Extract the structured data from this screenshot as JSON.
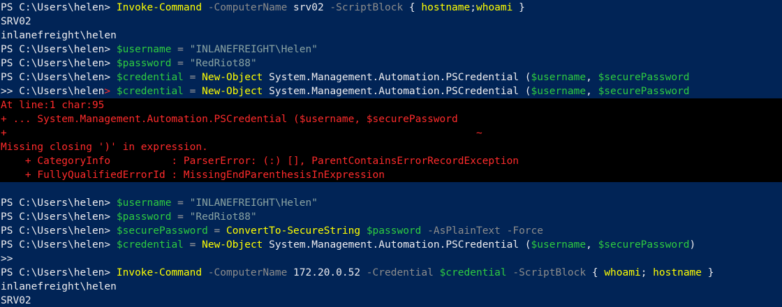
{
  "lines": [
    {
      "kind": "normal",
      "segs": [
        {
          "t": "PS C:\\Users\\helen> ",
          "c": "prompt"
        },
        {
          "t": "Invoke-Command",
          "c": "cmd"
        },
        {
          "t": " -ComputerName",
          "c": "param"
        },
        {
          "t": " srv02",
          "c": "plain"
        },
        {
          "t": " -ScriptBlock",
          "c": "param"
        },
        {
          "t": " { ",
          "c": "plain"
        },
        {
          "t": "hostname",
          "c": "cmd"
        },
        {
          "t": ";",
          "c": "plain"
        },
        {
          "t": "whoami",
          "c": "cmd"
        },
        {
          "t": " }",
          "c": "plain"
        }
      ]
    },
    {
      "kind": "normal",
      "segs": [
        {
          "t": "SRV02",
          "c": "plain"
        }
      ]
    },
    {
      "kind": "normal",
      "segs": [
        {
          "t": "inlanefreight\\helen",
          "c": "plain"
        }
      ]
    },
    {
      "kind": "normal",
      "segs": [
        {
          "t": "PS C:\\Users\\helen> ",
          "c": "prompt"
        },
        {
          "t": "$username",
          "c": "var"
        },
        {
          "t": " = ",
          "c": "op"
        },
        {
          "t": "\"INLANEFREIGHT\\Helen\"",
          "c": "str"
        }
      ]
    },
    {
      "kind": "normal",
      "segs": [
        {
          "t": "PS C:\\Users\\helen> ",
          "c": "prompt"
        },
        {
          "t": "$password",
          "c": "var"
        },
        {
          "t": " = ",
          "c": "op"
        },
        {
          "t": "\"RedRiot88\"",
          "c": "str"
        }
      ]
    },
    {
      "kind": "normal",
      "segs": [
        {
          "t": "PS C:\\Users\\helen> ",
          "c": "prompt"
        },
        {
          "t": "$credential",
          "c": "var"
        },
        {
          "t": " = ",
          "c": "op"
        },
        {
          "t": "New-Object",
          "c": "cmd"
        },
        {
          "t": " System.Management.Automation.PSCredential (",
          "c": "plain"
        },
        {
          "t": "$username",
          "c": "var"
        },
        {
          "t": ", ",
          "c": "plain"
        },
        {
          "t": "$securePassword",
          "c": "var"
        }
      ]
    },
    {
      "kind": "normal",
      "segs": [
        {
          "t": ">> C:\\Users\\helen",
          "c": "prompt"
        },
        {
          "t": ">",
          "c": "redch"
        },
        {
          "t": " ",
          "c": "plain"
        },
        {
          "t": "$credential",
          "c": "var"
        },
        {
          "t": " = ",
          "c": "op"
        },
        {
          "t": "New-Object",
          "c": "cmd"
        },
        {
          "t": " System.Management.Automation.PSCredential (",
          "c": "plain"
        },
        {
          "t": "$username",
          "c": "var"
        },
        {
          "t": ", ",
          "c": "plain"
        },
        {
          "t": "$securePassword",
          "c": "var"
        }
      ]
    },
    {
      "kind": "error",
      "segs": [
        {
          "t": "At line:1 char:95",
          "c": "plain"
        }
      ]
    },
    {
      "kind": "error",
      "segs": [
        {
          "t": "+ ... System.Management.Automation.PSCredential ($username, $securePassword",
          "c": "plain"
        }
      ]
    },
    {
      "kind": "error",
      "segs": [
        {
          "t": "+",
          "c": "plain"
        },
        {
          "t": "                                                                             ",
          "c": "ph"
        },
        {
          "t": "~",
          "c": "plain"
        }
      ]
    },
    {
      "kind": "error",
      "segs": [
        {
          "t": "Missing closing ')' in expression.",
          "c": "plain"
        }
      ]
    },
    {
      "kind": "error",
      "segs": [
        {
          "t": "    + CategoryInfo          : ParserError: (:) [], ParentContainsErrorRecordException",
          "c": "plain"
        }
      ]
    },
    {
      "kind": "error",
      "segs": [
        {
          "t": "    + FullyQualifiedErrorId : MissingEndParenthesisInExpression",
          "c": "plain"
        }
      ]
    },
    {
      "kind": "blank",
      "segs": []
    },
    {
      "kind": "normal",
      "segs": [
        {
          "t": "PS C:\\Users\\helen> ",
          "c": "prompt"
        },
        {
          "t": "$username",
          "c": "var"
        },
        {
          "t": " = ",
          "c": "op"
        },
        {
          "t": "\"INLANEFREIGHT\\Helen\"",
          "c": "str"
        }
      ]
    },
    {
      "kind": "normal",
      "segs": [
        {
          "t": "PS C:\\Users\\helen> ",
          "c": "prompt"
        },
        {
          "t": "$password",
          "c": "var"
        },
        {
          "t": " = ",
          "c": "op"
        },
        {
          "t": "\"RedRiot88\"",
          "c": "str"
        }
      ]
    },
    {
      "kind": "normal",
      "segs": [
        {
          "t": "PS C:\\Users\\helen> ",
          "c": "prompt"
        },
        {
          "t": "$securePassword",
          "c": "var"
        },
        {
          "t": " = ",
          "c": "op"
        },
        {
          "t": "ConvertTo-SecureString",
          "c": "cmd"
        },
        {
          "t": " ",
          "c": "plain"
        },
        {
          "t": "$password",
          "c": "var"
        },
        {
          "t": " -AsPlainText -Force",
          "c": "param"
        }
      ]
    },
    {
      "kind": "normal",
      "segs": [
        {
          "t": "PS C:\\Users\\helen> ",
          "c": "prompt"
        },
        {
          "t": "$credential",
          "c": "var"
        },
        {
          "t": " = ",
          "c": "op"
        },
        {
          "t": "New-Object",
          "c": "cmd"
        },
        {
          "t": " System.Management.Automation.PSCredential (",
          "c": "plain"
        },
        {
          "t": "$username",
          "c": "var"
        },
        {
          "t": ", ",
          "c": "plain"
        },
        {
          "t": "$securePassword",
          "c": "var"
        },
        {
          "t": ")",
          "c": "plain"
        }
      ]
    },
    {
      "kind": "normal",
      "segs": [
        {
          "t": ">>",
          "c": "prompt"
        }
      ]
    },
    {
      "kind": "normal",
      "segs": [
        {
          "t": "PS C:\\Users\\helen> ",
          "c": "prompt"
        },
        {
          "t": "Invoke-Command",
          "c": "cmd"
        },
        {
          "t": " -ComputerName",
          "c": "param"
        },
        {
          "t": " 172.20.0.52",
          "c": "plain"
        },
        {
          "t": " -Credential",
          "c": "param"
        },
        {
          "t": " ",
          "c": "plain"
        },
        {
          "t": "$credential",
          "c": "var"
        },
        {
          "t": " -ScriptBlock",
          "c": "param"
        },
        {
          "t": " { ",
          "c": "plain"
        },
        {
          "t": "whoami",
          "c": "cmd"
        },
        {
          "t": "; ",
          "c": "plain"
        },
        {
          "t": "hostname",
          "c": "cmd"
        },
        {
          "t": " }",
          "c": "plain"
        }
      ]
    },
    {
      "kind": "normal",
      "segs": [
        {
          "t": "inlanefreight\\helen",
          "c": "plain"
        }
      ]
    },
    {
      "kind": "normal",
      "segs": [
        {
          "t": "SRV02",
          "c": "plain"
        }
      ]
    }
  ]
}
